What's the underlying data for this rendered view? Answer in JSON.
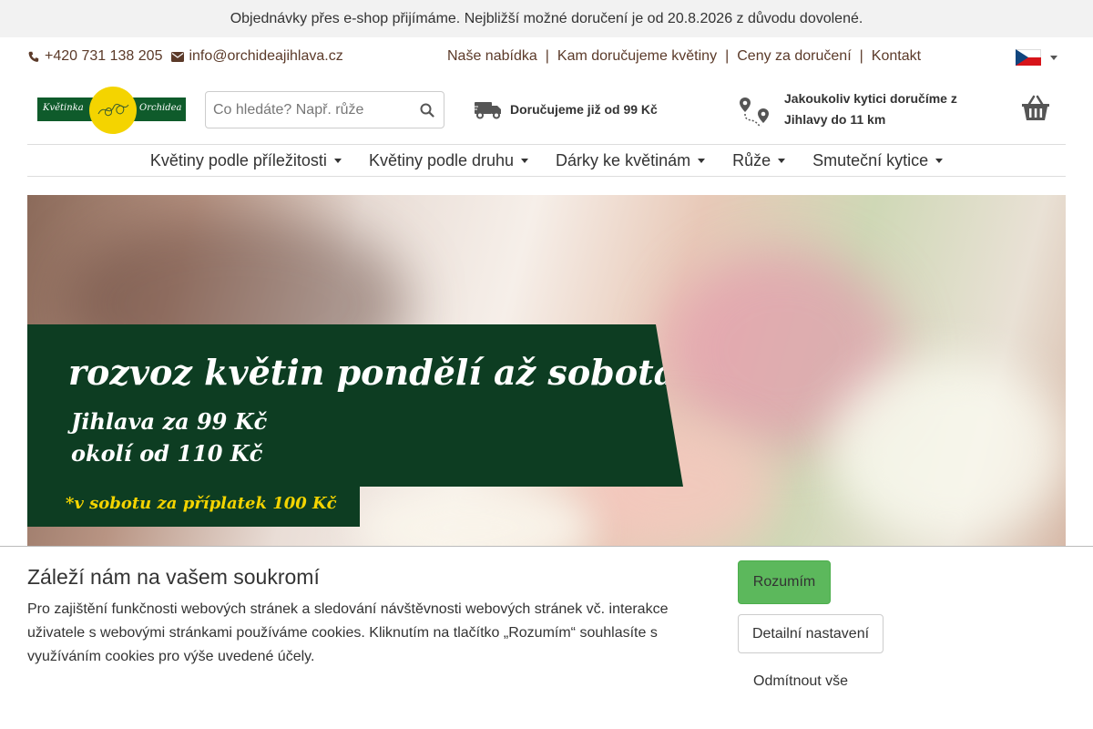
{
  "notice": {
    "text": "Objednávky přes e-shop přijímáme. Nejbližší možné doručení je od 20.8.2026 z důvodu dovolené."
  },
  "contact": {
    "phone": "+420 731 138 205",
    "email": "info@orchideajihlava.cz"
  },
  "top_nav": {
    "items": [
      "Naše nabídka",
      "Kam doručujeme květiny",
      "Ceny za doručení",
      "Kontakt"
    ],
    "separator": "|"
  },
  "language": {
    "flag_icon": "czech-flag-icon"
  },
  "logo": {
    "left_text": "Květinka",
    "right_text": "Orchidea",
    "colors": {
      "band": "#0f5b2b",
      "circle": "#f4d400"
    }
  },
  "search": {
    "placeholder": "Co hledáte? Např. růže",
    "icon": "search-icon"
  },
  "delivery": {
    "text": "Doručujeme již od 99 Kč",
    "icon": "truck-icon"
  },
  "range": {
    "text": "Jakoukoliv kytici doručíme z Jihlavy do 11 km",
    "icon": "map-route-icon"
  },
  "cart": {
    "icon": "basket-icon"
  },
  "main_nav": {
    "items": [
      "Květiny podle příležitosti",
      "Květiny podle druhu",
      "Dárky ke květinám",
      "Růže",
      "Smuteční kytice"
    ]
  },
  "hero": {
    "headline": "rozvoz květin pondělí až sobota",
    "headline_mark": "*",
    "line1": "Jihlava za 99 Kč",
    "line2": "okolí od 110 Kč",
    "footnote": "*v sobotu za příplatek 100 Kč",
    "colors": {
      "banner": "#0d3d22",
      "accent": "#f4d400"
    }
  },
  "cookie": {
    "title": "Záleží nám na vašem soukromí",
    "text": "Pro zajištění funkčnosti webových stránek a sledování návštěvnosti webových stránek vč. interakce uživatele s webovými stránkami používáme cookies. Kliknutím na tlačítko „Rozumím“ souhlasíte s využíváním cookies pro výše uvedené účely.",
    "accept_label": "Rozumím",
    "detail_label": "Detailní nastavení",
    "reject_label": "Odmítnout vše",
    "colors": {
      "accept": "#5cb85c"
    }
  }
}
